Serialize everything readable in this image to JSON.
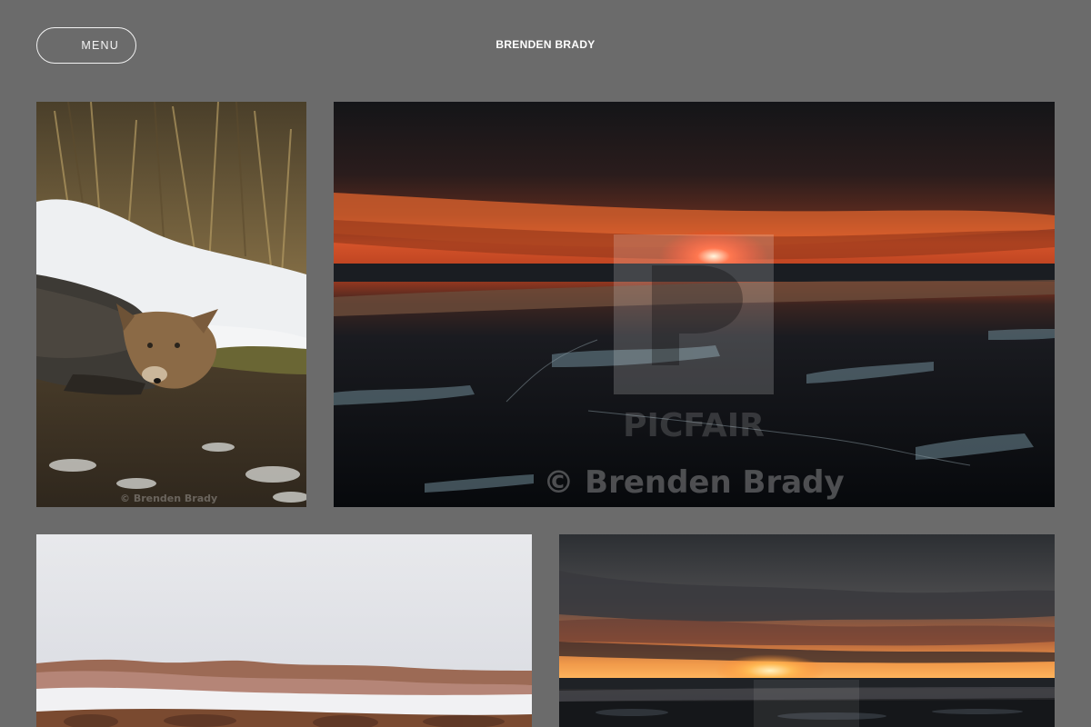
{
  "header": {
    "menu_label": "MENU",
    "site_title": "BRENDEN BRADY"
  },
  "gallery": {
    "photos": [
      {
        "subject": "coyote resting in snowy grass",
        "watermark": "© Brenden Brady"
      },
      {
        "subject": "sunset over river valley",
        "watermark": "© Brenden Brady",
        "watermark_brand": "PICFAIR"
      },
      {
        "subject": "snowy hills landscape"
      },
      {
        "subject": "sunset through clouds over river"
      }
    ]
  },
  "colors": {
    "background": "#6b6b6b",
    "header_text": "#ffffff"
  }
}
